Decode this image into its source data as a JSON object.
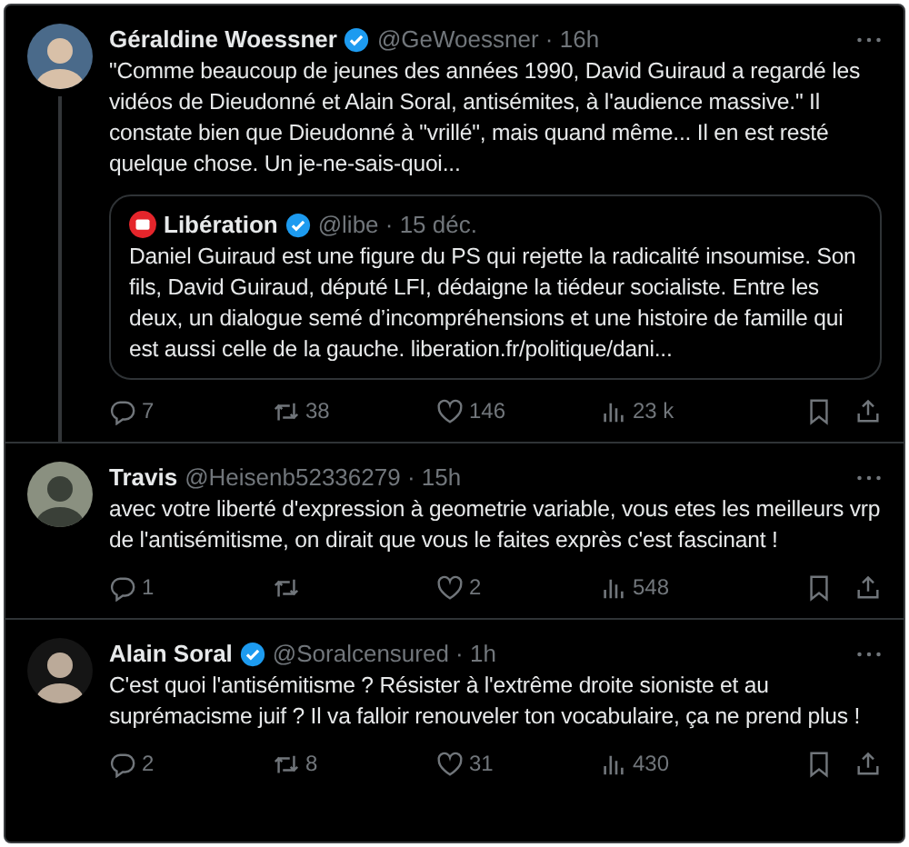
{
  "tweets": [
    {
      "name": "Géraldine Woessner",
      "verified": true,
      "handle": "@GeWoessner",
      "time": "· 16h",
      "thread": true,
      "text": "\"Comme beaucoup de jeunes des années 1990, David Guiraud a regardé les vidéos de Dieudonné et Alain Soral, antisémites, à l'audience massive.\" Il constate bien que Dieudonné à \"vrillé\", mais quand même... Il en est resté quelque chose. Un je-ne-sais-quoi...",
      "quote": {
        "name": "Libération",
        "verified": true,
        "handle": "@libe",
        "time": "· 15 déc.",
        "text": "Daniel Guiraud est une figure du PS qui rejette la radicalité insoumise. Son fils, David Guiraud, député LFI, dédaigne la tiédeur socialiste. Entre les deux, un dialogue semé d’incompréhensions et une histoire de famille qui est aussi celle de la gauche.",
        "link": "liberation.fr/politique/dani..."
      },
      "actions": [
        {
          "kind": "reply",
          "count": "7"
        },
        {
          "kind": "repost",
          "count": "38"
        },
        {
          "kind": "like",
          "count": "146"
        },
        {
          "kind": "views",
          "count": "23 k"
        }
      ]
    },
    {
      "name": "Travis",
      "verified": false,
      "handle": "@Heisenb52336279",
      "time": "· 15h",
      "thread": false,
      "text": "avec votre liberté d'expression à geometrie variable, vous etes les meilleurs vrp de l'antisémitisme, on dirait que vous le faites exprès c'est fascinant !",
      "actions": [
        {
          "kind": "reply",
          "count": "1"
        },
        {
          "kind": "repost"
        },
        {
          "kind": "like",
          "count": "2"
        },
        {
          "kind": "views",
          "count": "548"
        }
      ]
    },
    {
      "name": "Alain Soral",
      "verified": true,
      "handle": "@Soralcensured",
      "time": "· 1h",
      "thread": false,
      "text": "C'est quoi l'antisémitisme ? Résister à l'extrême droite sioniste et au suprémacisme juif ? Il va falloir renouveler ton vocabulaire, ça ne prend plus !",
      "actions": [
        {
          "kind": "reply",
          "count": "2"
        },
        {
          "kind": "repost",
          "count": "8"
        },
        {
          "kind": "like",
          "count": "31"
        },
        {
          "kind": "views",
          "count": "430"
        }
      ]
    }
  ]
}
